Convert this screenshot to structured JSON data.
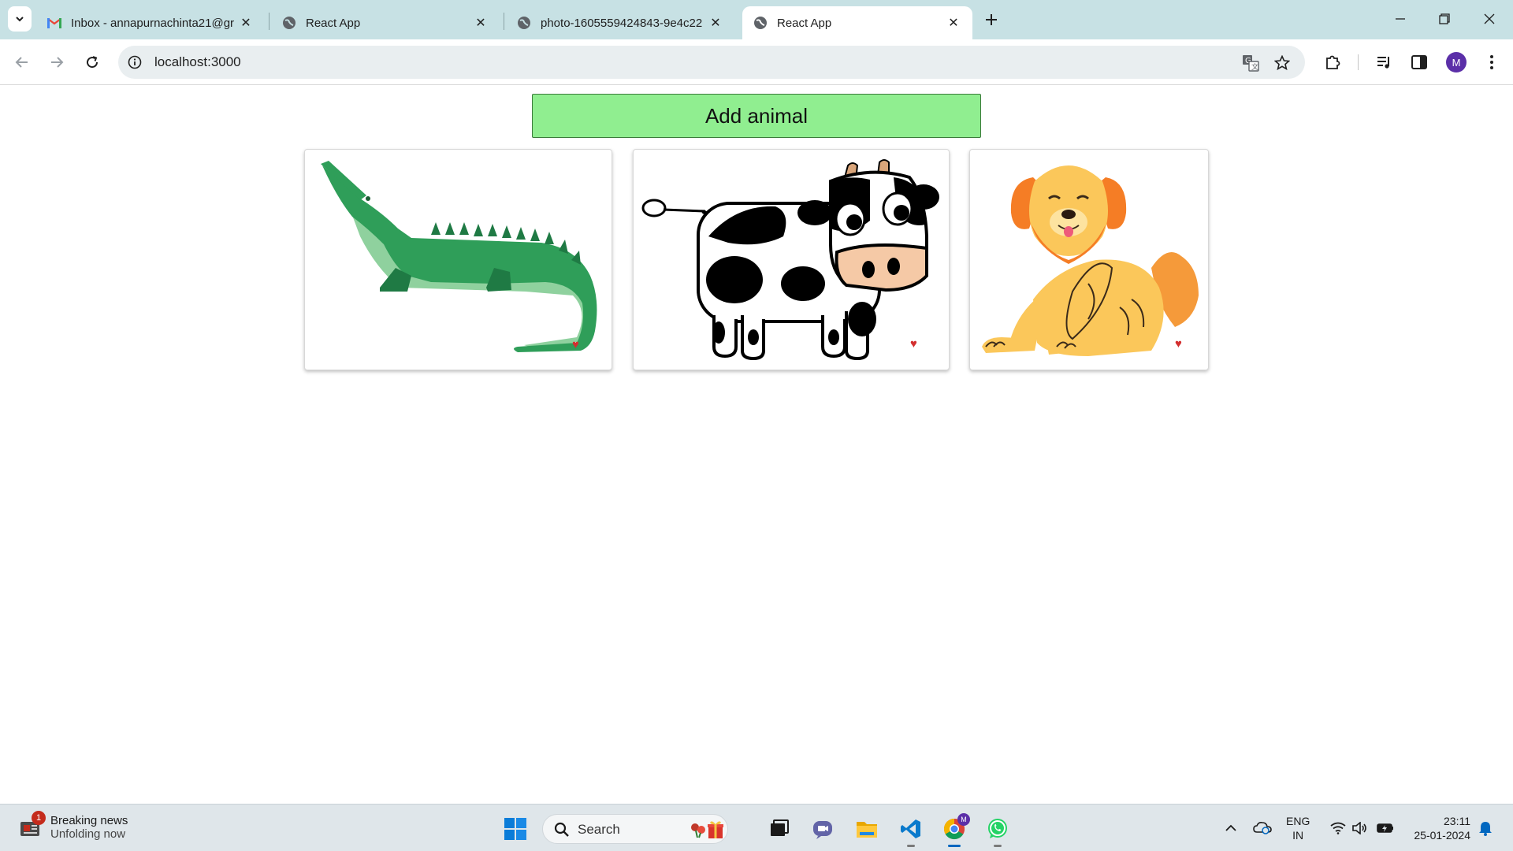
{
  "browser": {
    "tabs": [
      {
        "title": "Inbox - annapurnachinta21@gr",
        "favicon": "gmail-icon"
      },
      {
        "title": "React App",
        "favicon": "globe-icon"
      },
      {
        "title": "photo-1605559424843-9e4c22",
        "favicon": "globe-icon"
      },
      {
        "title": "React App",
        "favicon": "globe-icon",
        "active": true
      }
    ],
    "url": "localhost:3000",
    "profile_initial": "M"
  },
  "page": {
    "add_button_label": "Add animal",
    "animals": [
      {
        "name": "crocodile",
        "icon": "crocodile-image",
        "liked_icon": "heart-icon"
      },
      {
        "name": "cow",
        "icon": "cow-image",
        "liked_icon": "heart-icon"
      },
      {
        "name": "dog",
        "icon": "dog-image",
        "liked_icon": "heart-icon"
      }
    ],
    "heart_glyph": "♥",
    "heart_color": "#d32f2f",
    "button_color": "#90ee90"
  },
  "taskbar": {
    "news_badge": "1",
    "news_title": "Breaking news",
    "news_subtitle": "Unfolding now",
    "search_label": "Search",
    "lang_line1": "ENG",
    "lang_line2": "IN",
    "time": "23:11",
    "date": "25-01-2024"
  }
}
